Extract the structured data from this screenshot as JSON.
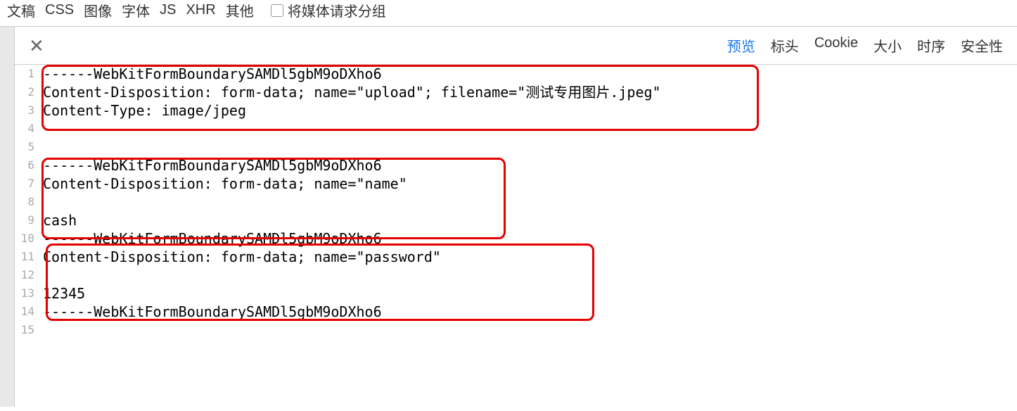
{
  "filters": {
    "items": [
      "文稿",
      "CSS",
      "图像",
      "字体",
      "JS",
      "XHR",
      "其他"
    ],
    "group_media_label": "将媒体请求分组"
  },
  "detail": {
    "tabs": [
      "预览",
      "标头",
      "Cookie",
      "大小",
      "时序",
      "安全性"
    ],
    "active_tab": "预览"
  },
  "code": {
    "lines": [
      "------WebKitFormBoundarySAMDl5gbM9oDXho6",
      "Content-Disposition: form-data; name=\"upload\"; filename=\"测试专用图片.jpeg\"",
      "Content-Type: image/jpeg",
      "",
      "",
      "------WebKitFormBoundarySAMDl5gbM9oDXho6",
      "Content-Disposition: form-data; name=\"name\"",
      "",
      "cash",
      "------WebKitFormBoundarySAMDl5gbM9oDXho6",
      "Content-Disposition: form-data; name=\"password\"",
      "",
      "12345",
      "------WebKitFormBoundarySAMDl5gbM9oDXho6",
      ""
    ]
  }
}
